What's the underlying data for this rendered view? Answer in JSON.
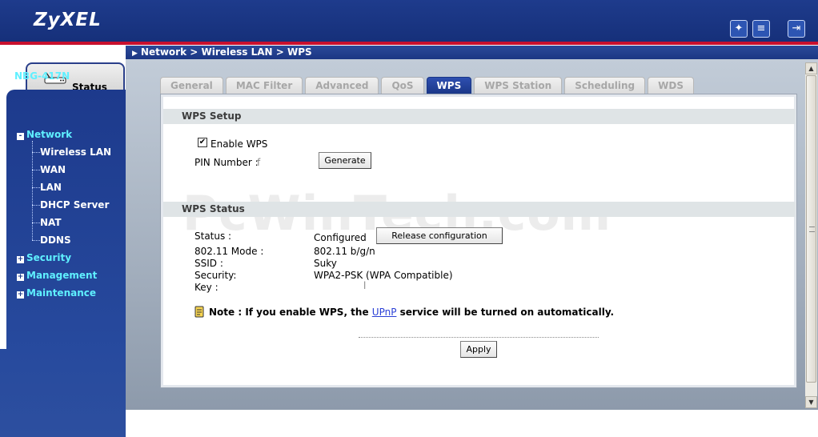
{
  "brand": {
    "logo": "ZyXEL"
  },
  "header": {
    "icons": [
      "wizard-icon",
      "notes-icon",
      "logout-icon"
    ],
    "breadcrumb": "Network > Wireless LAN > WPS"
  },
  "nav": {
    "status_tab": "Status",
    "device": "NBG-417N",
    "items": [
      {
        "label": "Network",
        "toggle": "-"
      },
      {
        "label": "Wireless LAN"
      },
      {
        "label": "WAN"
      },
      {
        "label": "LAN"
      },
      {
        "label": "DHCP Server"
      },
      {
        "label": "NAT"
      },
      {
        "label": "DDNS"
      },
      {
        "label": "Security",
        "toggle": "+"
      },
      {
        "label": "Management",
        "toggle": "+"
      },
      {
        "label": "Maintenance",
        "toggle": "+"
      }
    ]
  },
  "tabs": [
    "General",
    "MAC Filter",
    "Advanced",
    "QoS",
    "WPS",
    "WPS Station",
    "Scheduling",
    "WDS"
  ],
  "active_tab": "WPS",
  "wps_setup": {
    "title": "WPS Setup",
    "enable_label": "Enable WPS",
    "enable_checked": true,
    "pin_label": "PIN Number :",
    "pin_value": "f",
    "generate_button": "Generate"
  },
  "wps_status": {
    "title": "WPS Status",
    "status_label": "Status :",
    "status_value": "Configured",
    "release_button": "Release configuration",
    "mode_label": "802.11 Mode :",
    "mode_value": "802.11 b/g/n",
    "ssid_label": "SSID :",
    "ssid_value": "Suky",
    "security_label": "Security:",
    "security_value": "WPA2-PSK (WPA Compatible)",
    "key_label": "Key :",
    "key_value": "l"
  },
  "note": {
    "prefix": "Note : If you enable WPS, the",
    "link": "UPnP",
    "suffix": "service will be turned on automatically."
  },
  "apply_button": "Apply",
  "watermark": "PcWinTech.com",
  "colors": {
    "nav_blue": "#1d3a8c",
    "accent_red": "#c8102e",
    "nav_cyan": "#5ff0ff"
  }
}
